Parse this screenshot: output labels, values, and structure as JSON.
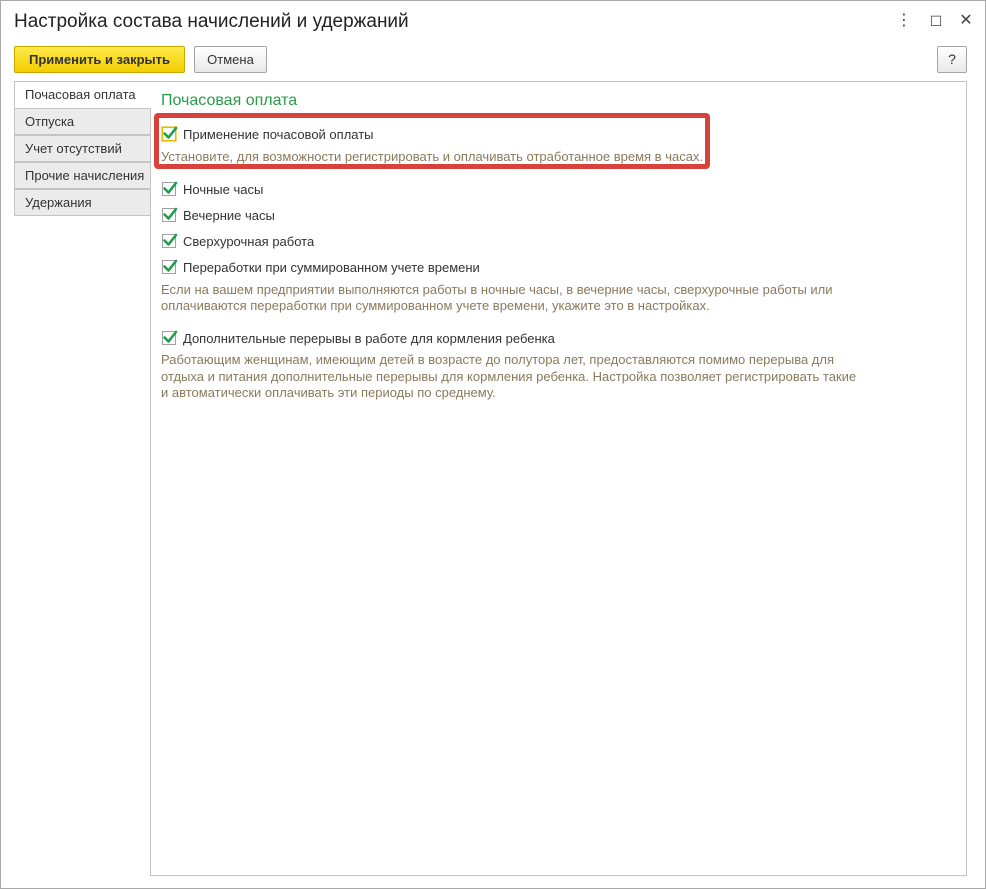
{
  "window": {
    "title": "Настройка состава начислений и удержаний",
    "menu_icon": "⋮",
    "maximize_icon": "☐",
    "close_icon": "✕"
  },
  "toolbar": {
    "apply_close_label": "Применить и закрыть",
    "cancel_label": "Отмена",
    "help_label": "?"
  },
  "tabs": [
    {
      "label": "Почасовая оплата",
      "active": true
    },
    {
      "label": "Отпуска",
      "active": false
    },
    {
      "label": "Учет отсутствий",
      "active": false
    },
    {
      "label": "Прочие начисления",
      "active": false
    },
    {
      "label": "Удержания",
      "active": false
    }
  ],
  "main": {
    "section_title": "Почасовая оплата",
    "hourly": {
      "label": "Применение почасовой оплаты",
      "checked": true,
      "hint": "Установите, для возможности регистрировать и оплачивать отработанное время в часах."
    },
    "options": [
      {
        "label": "Ночные часы",
        "checked": true
      },
      {
        "label": "Вечерние часы",
        "checked": true
      },
      {
        "label": "Сверхурочная работа",
        "checked": true
      },
      {
        "label": "Переработки при суммированном учете времени",
        "checked": true
      }
    ],
    "options_hint": [
      "Если на вашем предприятии выполняются работы в ночные часы, в вечерние часы, сверхурочные работы или",
      "оплачиваются переработки при суммированном учете времени, укажите это в настройках."
    ],
    "feeding": {
      "label": "Дополнительные перерывы в работе для кормления ребенка",
      "checked": true,
      "hint": [
        "Работающим женщинам, имеющим детей в возрасте до полутора лет, предоставляются помимо перерыва для",
        "отдыха и питания дополнительные перерывы для кормления ребенка. Настройка позволяет регистрировать такие",
        "и автоматически оплачивать эти периоды по среднему."
      ]
    }
  },
  "colors": {
    "accent_green": "#2b9a4b",
    "check_green": "#1e9e4a",
    "highlight_red": "#d9423c",
    "primary_button": "#f5d20a",
    "hint_text": "#8a7a5c"
  }
}
